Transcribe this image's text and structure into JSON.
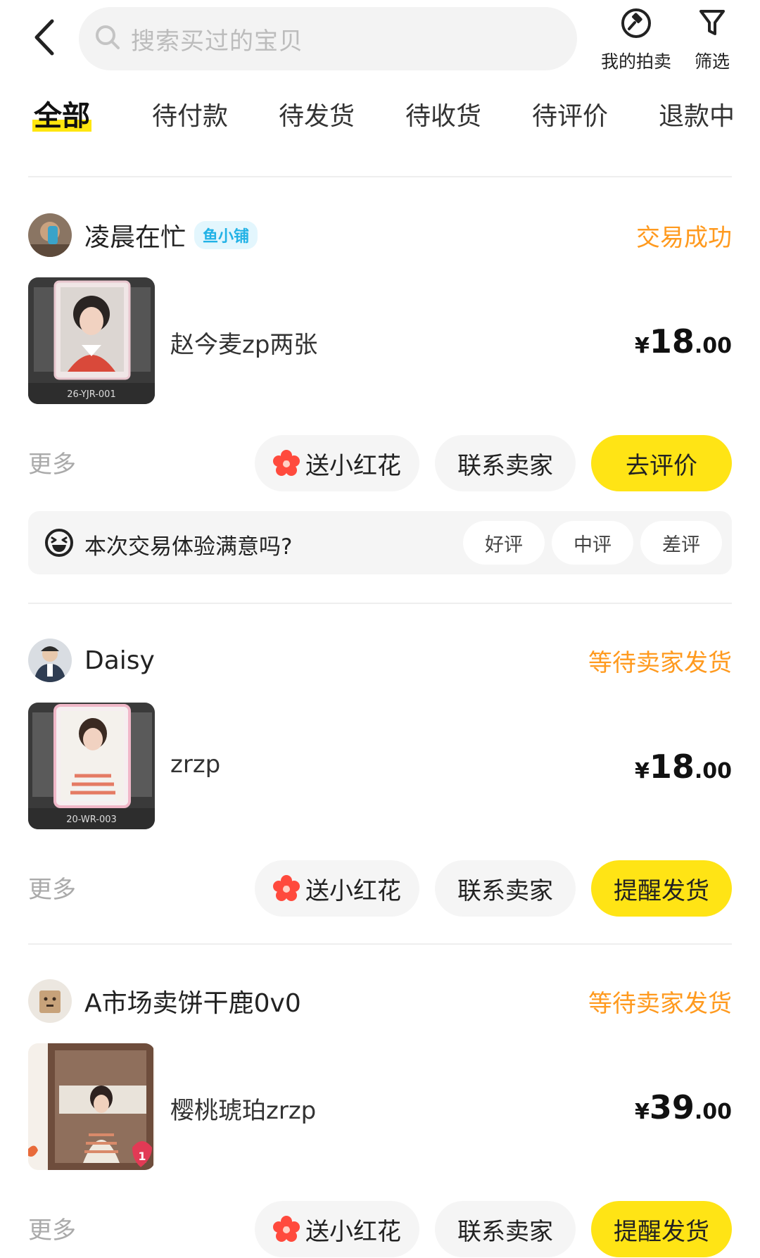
{
  "header": {
    "search_placeholder": "搜索买过的宝贝",
    "auction_label": "我的拍卖",
    "filter_label": "筛选"
  },
  "tabs": [
    {
      "label": "全部",
      "active": true
    },
    {
      "label": "待付款"
    },
    {
      "label": "待发货"
    },
    {
      "label": "待收货"
    },
    {
      "label": "待评价"
    },
    {
      "label": "退款中"
    }
  ],
  "orders": [
    {
      "seller": "凌晨在忙",
      "badge": "鱼小铺",
      "status": "交易成功",
      "item_title": "赵今麦zp两张",
      "thumb_caption": "26-YJR-001",
      "price": {
        "currency": "¥",
        "int": "18",
        "dec": ".00"
      },
      "more": "更多",
      "buttons": {
        "flower": "送小红花",
        "contact": "联系卖家",
        "primary": "去评价"
      },
      "survey": {
        "question": "本次交易体验满意吗?",
        "options": [
          "好评",
          "中评",
          "差评"
        ]
      }
    },
    {
      "seller": "Daisy",
      "status": "等待卖家发货",
      "item_title": "zrzp",
      "thumb_caption": "20-WR-003",
      "price": {
        "currency": "¥",
        "int": "18",
        "dec": ".00"
      },
      "more": "更多",
      "buttons": {
        "flower": "送小红花",
        "contact": "联系卖家",
        "primary": "提醒发货"
      }
    },
    {
      "seller": "A市场卖饼干鹿0v0",
      "status": "等待卖家发货",
      "item_title": "樱桃琥珀zrzp",
      "thumb_badge": "1",
      "price": {
        "currency": "¥",
        "int": "39",
        "dec": ".00"
      },
      "more": "更多",
      "buttons": {
        "flower": "送小红花",
        "contact": "联系卖家",
        "primary": "提醒发货"
      }
    }
  ],
  "colors": {
    "accent_yellow": "#ffe415",
    "status_orange": "#ff9a1f",
    "badge_blue": "#22b2e6"
  }
}
